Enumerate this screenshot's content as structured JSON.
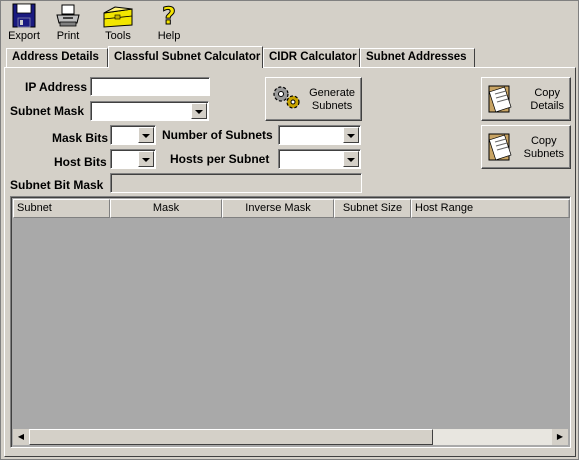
{
  "toolbar": {
    "export_label": "Export",
    "print_label": "Print",
    "tools_label": "Tools",
    "help_label": "Help"
  },
  "tabs": [
    {
      "label": "Address Details",
      "active": false
    },
    {
      "label": "Classful Subnet Calculator",
      "active": true
    },
    {
      "label": "CIDR Calculator",
      "active": false
    },
    {
      "label": "Subnet Addresses",
      "active": false
    }
  ],
  "form": {
    "ip_address_label": "IP Address",
    "ip_address_value": "",
    "subnet_mask_label": "Subnet Mask",
    "subnet_mask_value": "",
    "mask_bits_label": "Mask Bits",
    "mask_bits_value": "",
    "number_of_subnets_label": "Number of Subnets",
    "number_of_subnets_value": "",
    "host_bits_label": "Host Bits",
    "host_bits_value": "",
    "hosts_per_subnet_label": "Hosts per Subnet",
    "hosts_per_subnet_value": "",
    "subnet_bit_mask_label": "Subnet Bit Mask",
    "subnet_bit_mask_value": ""
  },
  "buttons": {
    "generate_line1": "Generate",
    "generate_line2": "Subnets",
    "copy_details_line1": "Copy",
    "copy_details_line2": "Details",
    "copy_subnets_line1": "Copy",
    "copy_subnets_line2": "Subnets"
  },
  "grid": {
    "columns": [
      "Subnet",
      "Mask",
      "Inverse Mask",
      "Subnet Size",
      "Host Range"
    ],
    "rows": []
  },
  "colors": {
    "window_bg": "#d4d0c8",
    "grid_bg": "#a9a9a9"
  }
}
